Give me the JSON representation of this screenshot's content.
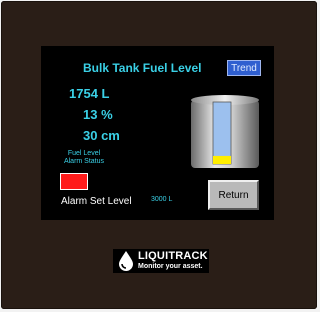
{
  "screen": {
    "title": "Bulk Tank Fuel Level",
    "trend_button": "Trend",
    "volume": "1754 L",
    "percent": "13 %",
    "height": "30 cm",
    "alarm_status_label_line1": "Fuel Level",
    "alarm_status_label_line2": "Alarm Status",
    "alarm_status_color": "#ff1b1b",
    "alarm_set_level_label": "Alarm Set Level",
    "alarm_set_level_value": "3000 L",
    "return_button": "Return",
    "tank_fill_fraction": 0.13,
    "tank_fill_color": "#ffee00",
    "accent_color": "#3ad0e6"
  },
  "branding": {
    "brand_name": "LIQUITRACK",
    "tagline": "Monitor your asset."
  }
}
